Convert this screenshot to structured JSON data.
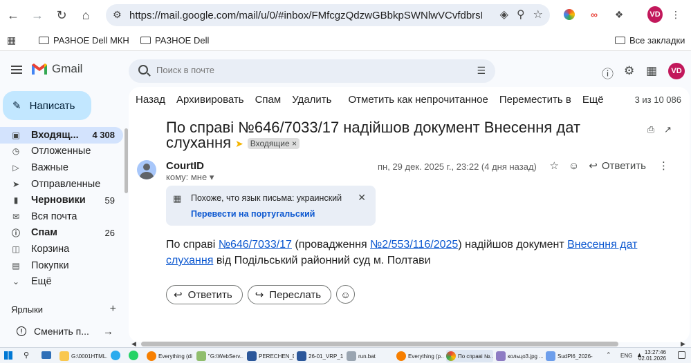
{
  "browser": {
    "url": "https://mail.google.com/mail/u/0/#inbox/FMfcgzQdzwGBbkpSWNlwVCvfdbrsKn...",
    "profile_initials": "VD",
    "bookmarks": [
      "РАЗНОЕ Dell МКН",
      "РАЗНОЕ Dell"
    ],
    "all_bookmarks": "Все закладки"
  },
  "gmail": {
    "logo_text": "Gmail",
    "search_placeholder": "Поиск в почте",
    "compose_label": "Написать",
    "nav": [
      {
        "label": "Входящ...",
        "count": "4 308",
        "icon": "inbox-icon",
        "active": true
      },
      {
        "label": "Отложенные",
        "count": "",
        "icon": "clock-icon"
      },
      {
        "label": "Важные",
        "count": "",
        "icon": "label-important-icon"
      },
      {
        "label": "Отправленные",
        "count": "",
        "icon": "send-icon"
      },
      {
        "label": "Черновики",
        "count": "59",
        "icon": "draft-icon",
        "bold": true
      },
      {
        "label": "Вся почта",
        "count": "",
        "icon": "all-mail-icon"
      },
      {
        "label": "Спам",
        "count": "26",
        "icon": "spam-icon",
        "bold": true
      },
      {
        "label": "Корзина",
        "count": "",
        "icon": "trash-icon"
      },
      {
        "label": "Покупки",
        "count": "",
        "icon": "shopping-icon"
      },
      {
        "label": "Ещё",
        "count": "",
        "icon": "chevron-down-icon"
      }
    ],
    "labels_header": "Ярлыки",
    "switch_account": "Сменить п...",
    "toolbar": {
      "back": "Назад",
      "archive": "Архивировать",
      "spam": "Спам",
      "delete": "Удалить",
      "mark_unread": "Отметить как непрочитанное",
      "move": "Переместить в",
      "more": "Ещё",
      "pager": "3 из 10 086"
    },
    "message": {
      "subject": "По справі №646/7033/17 надійшов документ Внесення дат слухання",
      "label_chip": "Входящие ×",
      "sender": "CourtID",
      "to": "кому: мне ▾",
      "date": "пн, 29 дек. 2025 г., 23:22 (4 дня назад)",
      "reply_label": "Ответить",
      "translate_notice": "Похоже, что язык письма: украинский",
      "translate_link": "Перевести на португальский",
      "body": {
        "p1": "По справі ",
        "link1": "№646/7033/17",
        "p2": " (провадження ",
        "link2": "№2/553/116/2025",
        "p3": ") надійшов документ ",
        "link3": "Внесення дат слухання",
        "p4": " від Подільський районний суд м. Полтави"
      },
      "reply_button": "Ответить",
      "forward_button": "Переслать"
    }
  },
  "taskbar": {
    "apps": [
      {
        "label": "G:\\0001HTML...",
        "color": "#f9c74f"
      },
      {
        "label": "Everything (di...",
        "color": "#f77f00"
      },
      {
        "label": "\"G:\\WebServ...",
        "color": "#90be6d"
      },
      {
        "label": "PERECHEN_D...",
        "color": "#2b579a"
      },
      {
        "label": "26-01_VRP_1...",
        "color": "#2b579a"
      },
      {
        "label": "run.bat",
        "color": "#9aa5b1"
      },
      {
        "label": "Everything (p...",
        "color": "#f77f00"
      },
      {
        "label": "По справі №...",
        "color": "#ea4335"
      },
      {
        "label": "кольцо3.jpg ...",
        "color": "#8e7cc3"
      },
      {
        "label": "SudPl6_2026-...",
        "color": "#6d9eeb"
      }
    ],
    "lang": "ENG",
    "time": "13:27:46",
    "date": "02.01.2026"
  }
}
